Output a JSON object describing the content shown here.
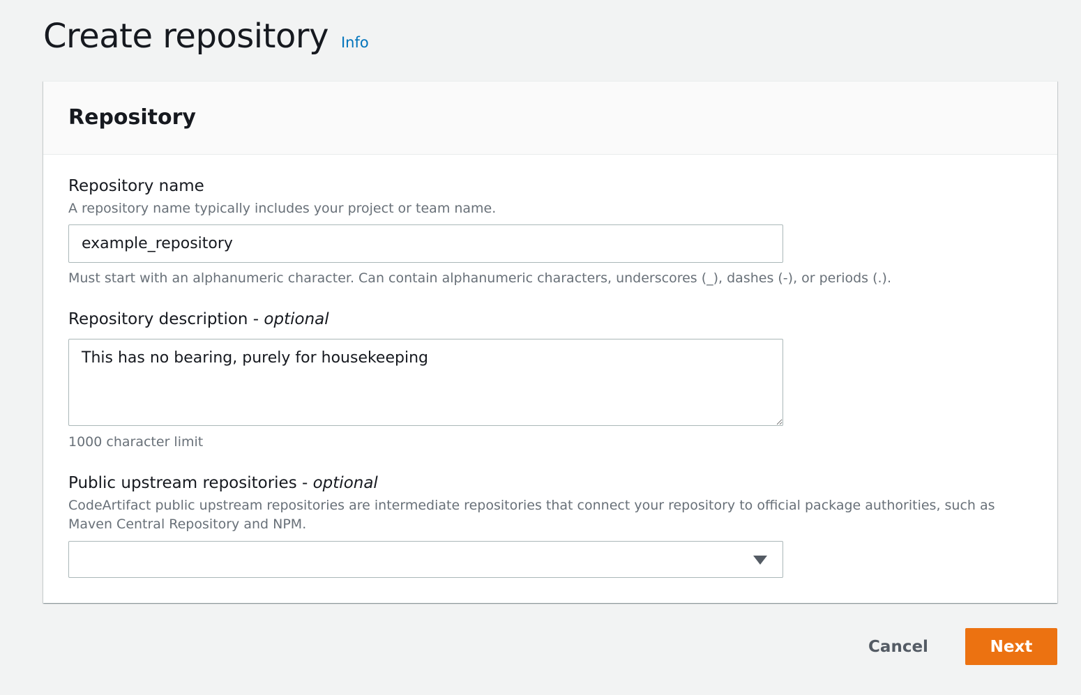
{
  "header": {
    "title": "Create repository",
    "info_link": "Info"
  },
  "panel": {
    "title": "Repository",
    "repo_name": {
      "label": "Repository name",
      "description": "A repository name typically includes your project or team name.",
      "value": "example_repository",
      "constraint": "Must start with an alphanumeric character. Can contain alphanumeric characters, underscores (_), dashes (-), or periods (.)."
    },
    "repo_description": {
      "label": "Repository description - ",
      "optional": "optional",
      "value": "This has no bearing, purely for housekeeping",
      "constraint": "1000 character limit"
    },
    "upstream": {
      "label": "Public upstream repositories - ",
      "optional": "optional",
      "description": "CodeArtifact public upstream repositories are intermediate repositories that connect your repository to official package authorities, such as Maven Central Repository and NPM.",
      "selected": ""
    }
  },
  "actions": {
    "cancel": "Cancel",
    "next": "Next"
  },
  "colors": {
    "accent": "#ec7211",
    "link": "#0073bb",
    "background": "#f2f3f3"
  }
}
